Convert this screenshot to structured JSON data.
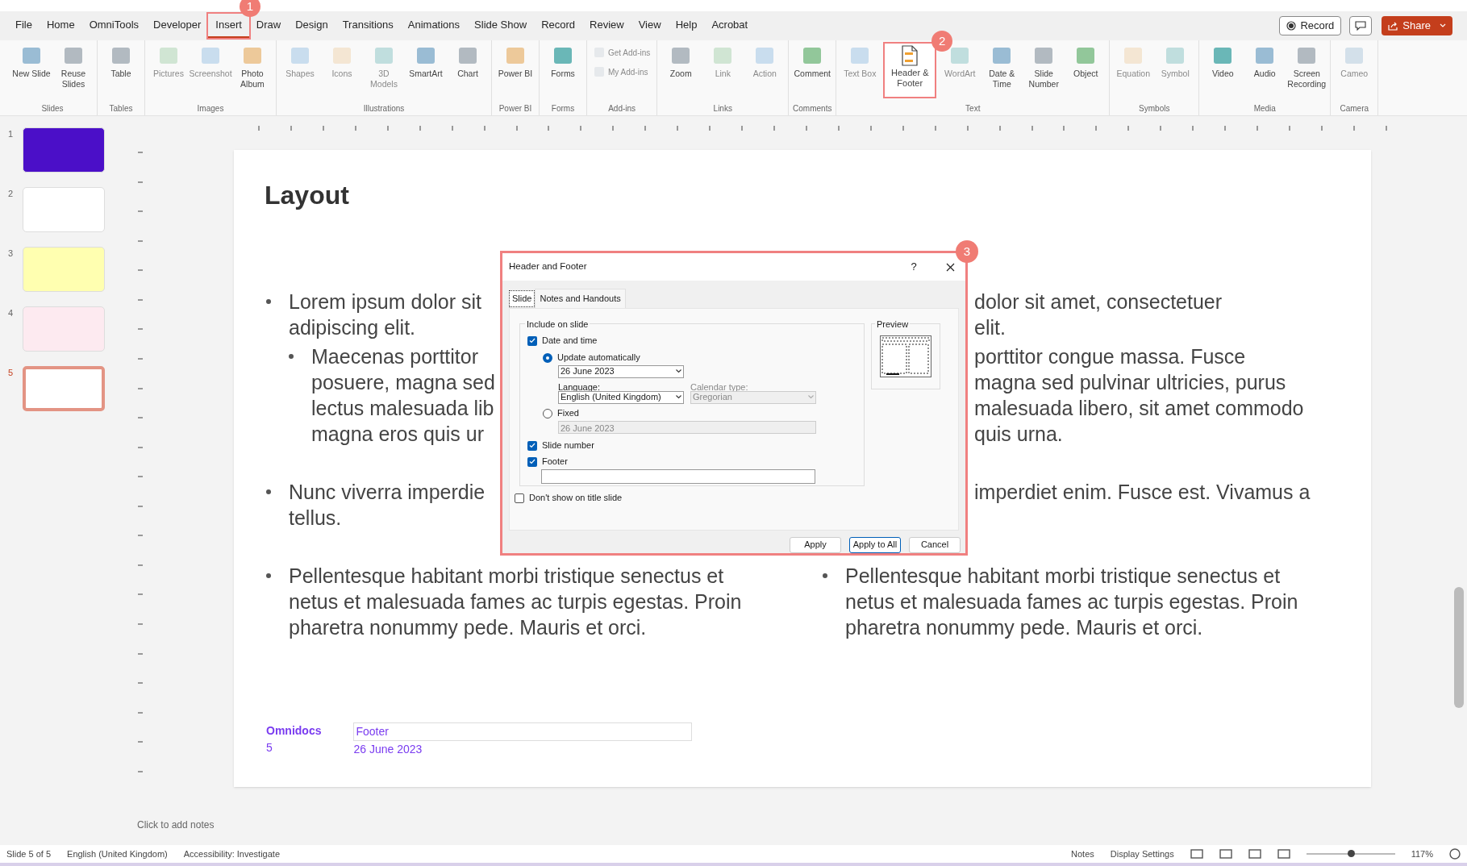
{
  "menu": {
    "tabs": [
      {
        "label": "File",
        "selected": false
      },
      {
        "label": "Home",
        "selected": false
      },
      {
        "label": "OmniTools",
        "selected": false
      },
      {
        "label": "Developer",
        "selected": false
      },
      {
        "label": "Insert",
        "selected": true,
        "annotation": "1"
      },
      {
        "label": "Draw",
        "selected": false
      },
      {
        "label": "Design",
        "selected": false
      },
      {
        "label": "Transitions",
        "selected": false
      },
      {
        "label": "Animations",
        "selected": false
      },
      {
        "label": "Slide Show",
        "selected": false
      },
      {
        "label": "Record",
        "selected": false
      },
      {
        "label": "Review",
        "selected": false
      },
      {
        "label": "View",
        "selected": false
      },
      {
        "label": "Help",
        "selected": false
      },
      {
        "label": "Acrobat",
        "selected": false
      }
    ],
    "record_button": "Record",
    "share_button": "Share"
  },
  "ribbon": {
    "groups": [
      {
        "label": "Slides",
        "items": [
          {
            "label": "New Slide",
            "kind": "large",
            "disabled": false
          },
          {
            "label": "Reuse Slides",
            "kind": "large",
            "disabled": false
          }
        ]
      },
      {
        "label": "Tables",
        "items": [
          {
            "label": "Table",
            "kind": "large",
            "disabled": false
          }
        ]
      },
      {
        "label": "Images",
        "items": [
          {
            "label": "Pictures",
            "kind": "large",
            "disabled": true
          },
          {
            "label": "Screenshot",
            "kind": "large",
            "disabled": true
          },
          {
            "label": "Photo Album",
            "kind": "large",
            "disabled": false
          }
        ]
      },
      {
        "label": "Illustrations",
        "items": [
          {
            "label": "Shapes",
            "kind": "large",
            "disabled": true
          },
          {
            "label": "Icons",
            "kind": "large",
            "disabled": true
          },
          {
            "label": "3D Models",
            "kind": "large",
            "disabled": true
          },
          {
            "label": "SmartArt",
            "kind": "large",
            "disabled": false
          },
          {
            "label": "Chart",
            "kind": "large",
            "disabled": false
          }
        ]
      },
      {
        "label": "Power BI",
        "items": [
          {
            "label": "Power BI",
            "kind": "large",
            "disabled": false
          }
        ]
      },
      {
        "label": "Forms",
        "items": [
          {
            "label": "Forms",
            "kind": "large",
            "disabled": false
          }
        ]
      },
      {
        "label": "Add-ins",
        "items": [
          {
            "label": "Get Add-ins",
            "kind": "small",
            "disabled": true
          },
          {
            "label": "My Add-ins",
            "kind": "small",
            "disabled": true
          }
        ]
      },
      {
        "label": "Links",
        "items": [
          {
            "label": "Zoom",
            "kind": "large",
            "disabled": false
          },
          {
            "label": "Link",
            "kind": "large",
            "disabled": true
          },
          {
            "label": "Action",
            "kind": "large",
            "disabled": true
          }
        ]
      },
      {
        "label": "Comments",
        "items": [
          {
            "label": "Comment",
            "kind": "large",
            "disabled": false
          }
        ]
      },
      {
        "label": "Text",
        "items": [
          {
            "label": "Text Box",
            "kind": "large",
            "disabled": true
          },
          {
            "label": "Header & Footer",
            "kind": "large",
            "disabled": false,
            "annotation": "2"
          },
          {
            "label": "WordArt",
            "kind": "large",
            "disabled": true
          },
          {
            "label": "Date & Time",
            "kind": "large",
            "disabled": false
          },
          {
            "label": "Slide Number",
            "kind": "large",
            "disabled": false
          },
          {
            "label": "Object",
            "kind": "large",
            "disabled": false
          }
        ]
      },
      {
        "label": "Symbols",
        "items": [
          {
            "label": "Equation",
            "kind": "large",
            "disabled": true
          },
          {
            "label": "Symbol",
            "kind": "large",
            "disabled": true
          }
        ]
      },
      {
        "label": "Media",
        "items": [
          {
            "label": "Video",
            "kind": "large",
            "disabled": false
          },
          {
            "label": "Audio",
            "kind": "large",
            "disabled": false
          },
          {
            "label": "Screen Recording",
            "kind": "large",
            "disabled": false
          }
        ]
      },
      {
        "label": "Camera",
        "items": [
          {
            "label": "Cameo",
            "kind": "large",
            "disabled": true
          }
        ]
      }
    ]
  },
  "thumbnails": [
    {
      "number": "1",
      "selected": false,
      "color": "#4b0fc8"
    },
    {
      "number": "2",
      "selected": false,
      "color": "#ffffff"
    },
    {
      "number": "3",
      "selected": false,
      "color": "#ffffb0"
    },
    {
      "number": "4",
      "selected": false,
      "color": "#fdeaf0"
    },
    {
      "number": "5",
      "selected": true,
      "color": "#ffffff"
    }
  ],
  "slide": {
    "title": "Layout",
    "columns": [
      {
        "bullets": [
          {
            "lines": [
              {
                "text": "Lorem ipsum dolor sit"
              },
              {
                "text": "adipiscing elit."
              }
            ],
            "children": [
              {
                "lines": [
                  {
                    "text": "Maecenas porttitor"
                  },
                  {
                    "text": "posuere, magna sed"
                  },
                  {
                    "text": "lectus malesuada lib"
                  },
                  {
                    "text": "magna eros quis ur"
                  }
                ]
              }
            ]
          },
          {
            "lines": [
              {
                "text": "Nunc viverra imperdie"
              },
              {
                "text": "tellus."
              }
            ]
          },
          {
            "lines": [
              {
                "text": "Pellentesque habitant morbi tristique senectus et"
              },
              {
                "text": "netus et malesuada fames ac turpis egestas. Proin"
              },
              {
                "text": "pharetra nonummy pede. Mauris et orci."
              }
            ]
          }
        ]
      },
      {
        "bullets": [
          {
            "lines": [
              {
                "text": "dolor sit amet, consectetuer",
                "clipped": true
              },
              {
                "text": "elit.",
                "clipped": true
              }
            ],
            "children": [
              {
                "lines": [
                  {
                    "text": "porttitor congue massa. Fusce",
                    "clipped": true
                  },
                  {
                    "text": "magna sed pulvinar ultricies, purus",
                    "clipped": true
                  },
                  {
                    "text": "malesuada libero, sit amet commodo",
                    "clipped": true
                  },
                  {
                    "text": "quis urna.",
                    "clipped": true
                  }
                ]
              }
            ]
          },
          {
            "lines": [
              {
                "text": "imperdiet enim. Fusce est. Vivamus a",
                "clipped": true
              }
            ]
          },
          {
            "lines": [
              {
                "text": "Pellentesque habitant morbi tristique senectus et"
              },
              {
                "text": "netus et malesuada fames ac turpis egestas. Proin"
              },
              {
                "text": "pharetra nonummy pede. Mauris et orci."
              }
            ]
          }
        ]
      }
    ],
    "footer": {
      "brand": "Omnidocs",
      "number": "5",
      "footer_text": "Footer",
      "date": "26 June 2023"
    }
  },
  "notes_placeholder": "Click to add notes",
  "status_bar": {
    "slide_count": "Slide 5 of 5",
    "language": "English (United Kingdom)",
    "accessibility": "Accessibility: Investigate",
    "notes": "Notes",
    "display_settings": "Display Settings",
    "zoom": {
      "level": 0.5,
      "reading": "117%"
    }
  },
  "dialog": {
    "title": "Header and Footer",
    "help": "?",
    "annotation": "3",
    "tabs": [
      {
        "label": "Slide",
        "selected": true
      },
      {
        "label": "Notes and Handouts",
        "selected": false
      }
    ],
    "group_label": "Include on slide",
    "date_time": {
      "label": "Date and time",
      "checked": true
    },
    "update_auto": {
      "label": "Update automatically",
      "selected": true
    },
    "date_select": {
      "value": "26 June 2023"
    },
    "language": {
      "label": "Language:",
      "value": "English (United Kingdom)",
      "disabled": false
    },
    "calendar": {
      "label": "Calendar type:",
      "value": "Gregorian",
      "disabled": true
    },
    "fixed": {
      "label": "Fixed",
      "selected": false
    },
    "fixed_field": {
      "value": "26 June 2023",
      "disabled": true
    },
    "slide_number": {
      "label": "Slide number",
      "checked": true
    },
    "footer": {
      "label": "Footer",
      "checked": true
    },
    "dont_show": {
      "label": "Don't show on title slide",
      "checked": false
    },
    "preview_label": "Preview",
    "buttons": [
      {
        "label": "Apply",
        "default": false
      },
      {
        "label": "Apply to All",
        "default": true
      },
      {
        "label": "Cancel",
        "default": false
      }
    ]
  }
}
